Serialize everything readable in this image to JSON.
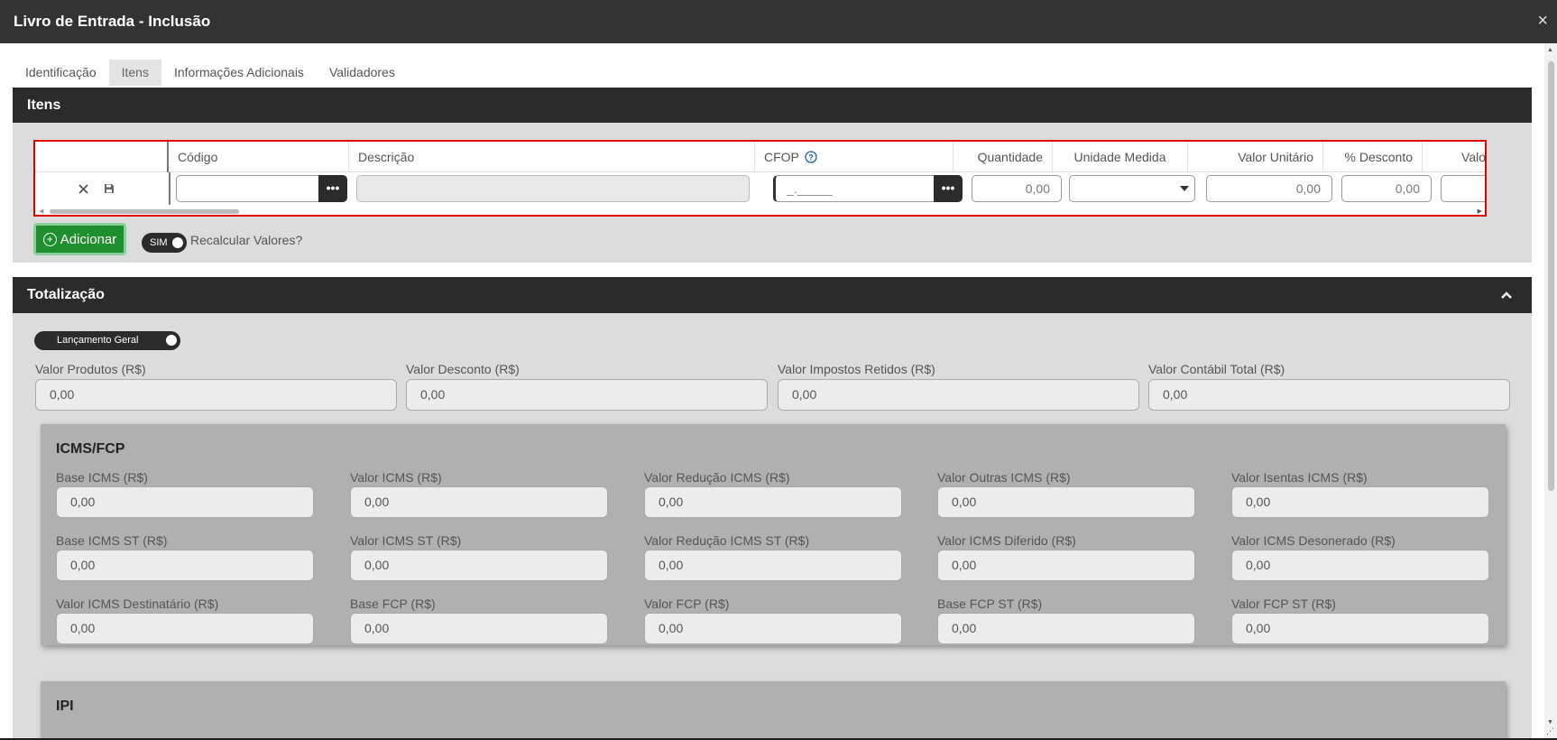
{
  "window": {
    "title": "Livro de Entrada - Inclusão",
    "close_icon": "×"
  },
  "tabs": [
    {
      "label": "Identificação"
    },
    {
      "label": "Itens"
    },
    {
      "label": "Informações Adicionais"
    },
    {
      "label": "Validadores"
    }
  ],
  "itens": {
    "header": "Itens",
    "columns": {
      "codigo": "Código",
      "descricao": "Descrição",
      "cfop": "CFOP",
      "quantidade": "Quantidade",
      "unidade": "Unidade Medida",
      "valor_unitario": "Valor Unitário",
      "desconto": "% Desconto",
      "valor_cut": "Valo"
    },
    "row": {
      "codigo": "",
      "cfop_mask": "_._____",
      "quantidade": "0,00",
      "valor_unitario": "0,00",
      "desconto": "0,00",
      "dots": "•••"
    },
    "add_label": "Adicionar",
    "recalc_toggle": "SIM",
    "recalc_label": "Recalcular Valores?"
  },
  "totalizacao": {
    "header": "Totalização",
    "toggle_label": "Lançamento Geral",
    "fields": [
      {
        "label": "Valor Produtos (R$)",
        "value": "0,00"
      },
      {
        "label": "Valor Desconto (R$)",
        "value": "0,00"
      },
      {
        "label": "Valor Impostos Retidos (R$)",
        "value": "0,00"
      },
      {
        "label": "Valor Contábil Total (R$)",
        "value": "0,00"
      }
    ],
    "icms": {
      "title": "ICMS/FCP",
      "fields": [
        {
          "label": "Base ICMS (R$)",
          "value": "0,00"
        },
        {
          "label": "Valor ICMS (R$)",
          "value": "0,00"
        },
        {
          "label": "Valor Redução ICMS (R$)",
          "value": "0,00"
        },
        {
          "label": "Valor Outras ICMS (R$)",
          "value": "0,00"
        },
        {
          "label": "Valor Isentas ICMS (R$)",
          "value": "0,00"
        },
        {
          "label": "Base ICMS ST (R$)",
          "value": "0,00"
        },
        {
          "label": "Valor ICMS ST (R$)",
          "value": "0,00"
        },
        {
          "label": "Valor Redução ICMS ST (R$)",
          "value": "0,00"
        },
        {
          "label": "Valor ICMS Diferido (R$)",
          "value": "0,00"
        },
        {
          "label": "Valor ICMS Desonerado (R$)",
          "value": "0,00"
        },
        {
          "label": "Valor ICMS Destinatário (R$)",
          "value": "0,00"
        },
        {
          "label": "Base FCP (R$)",
          "value": "0,00"
        },
        {
          "label": "Valor FCP (R$)",
          "value": "0,00"
        },
        {
          "label": "Base FCP ST (R$)",
          "value": "0,00"
        },
        {
          "label": "Valor FCP ST (R$)",
          "value": "0,00"
        }
      ]
    },
    "ipi": {
      "title": "IPI"
    }
  }
}
